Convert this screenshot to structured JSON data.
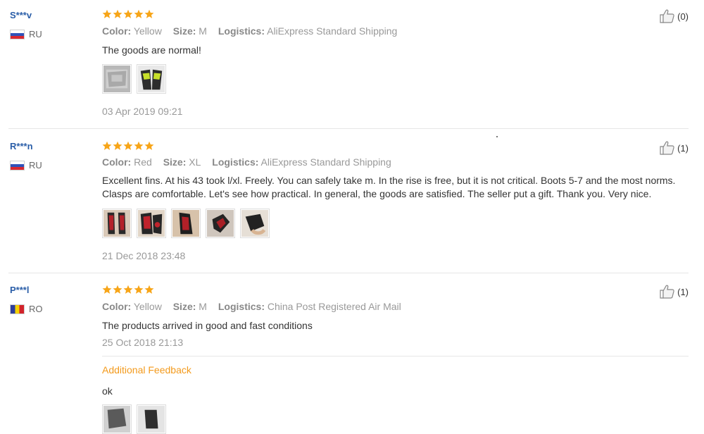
{
  "colors": {
    "star": "#f7a518",
    "username": "#2a5ea8",
    "additional": "#f39a1c"
  },
  "reviews": [
    {
      "user": "S***v",
      "country": "RU",
      "flag_icon": "russia-flag-icon",
      "rating": 5,
      "color_label": "Color:",
      "color": "Yellow",
      "size_label": "Size:",
      "size": "M",
      "logistics_label": "Logistics:",
      "logistics": "AliExpress Standard Shipping",
      "text": "The goods are normal!",
      "photos": [
        "photo-thumbnail",
        "photo-thumbnail"
      ],
      "date": "03 Apr 2019 09:21",
      "helpful": "(0)"
    },
    {
      "user": "R***n",
      "country": "RU",
      "flag_icon": "russia-flag-icon",
      "rating": 5,
      "color_label": "Color:",
      "color": "Red",
      "size_label": "Size:",
      "size": "XL",
      "logistics_label": "Logistics:",
      "logistics": "AliExpress Standard Shipping",
      "text": "Excellent fins. At his 43 took l/xl. Freely. You can safely take m. In the rise is free, but it is not critical. Boots 5-7 and the most norms. Clasps are comfortable. Let's see how practical. In general, the goods are satisfied. The seller put a gift. Thank you. Very nice.",
      "photos": [
        "photo-thumbnail",
        "photo-thumbnail",
        "photo-thumbnail",
        "photo-thumbnail",
        "photo-thumbnail"
      ],
      "date": "21 Dec 2018 23:48",
      "helpful": "(1)"
    },
    {
      "user": "P***l",
      "country": "RO",
      "flag_icon": "romania-flag-icon",
      "rating": 5,
      "color_label": "Color:",
      "color": "Yellow",
      "size_label": "Size:",
      "size": "M",
      "logistics_label": "Logistics:",
      "logistics": "China Post Registered Air Mail",
      "text": "The products arrived in good and fast conditions",
      "date": "25 Oct 2018 21:13",
      "helpful": "(1)",
      "additional_title": "Additional Feedback",
      "additional_text": "ok",
      "photos": [
        "photo-thumbnail",
        "photo-thumbnail"
      ]
    }
  ]
}
